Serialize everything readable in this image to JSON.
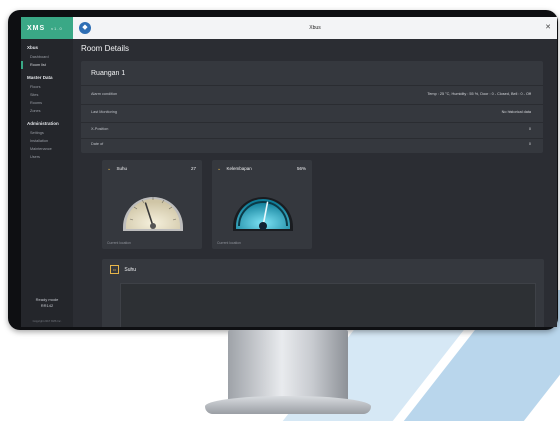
{
  "sidebar": {
    "logo": "XMS",
    "version": "v1.0",
    "sections": [
      {
        "title": "Xbus",
        "items": [
          "Dashboard",
          "Room list"
        ]
      },
      {
        "title": "Master Data",
        "items": [
          "Floors",
          "Sites",
          "Rooms",
          "Zones"
        ]
      },
      {
        "title": "Administration",
        "items": [
          "Settings",
          "Installation",
          "Maintenance",
          "Users"
        ]
      }
    ],
    "active_item": "Room list",
    "footer_line1": "Ready mode",
    "footer_line2": "RR142",
    "copyright": "Copyright 2017 XMS Inc."
  },
  "topbar": {
    "title": "Xbus",
    "close_glyph": "✕"
  },
  "page": {
    "title": "Room Details"
  },
  "room": {
    "name": "Ruangan 1",
    "rows": [
      {
        "key": "Alarm condition",
        "value": "Temp : 25 °C, Humidity : 55 %, Door : 0 - Closed, Bell : 0 - Off"
      },
      {
        "key": "Last Monitoring",
        "value": "No historical data"
      },
      {
        "key": "X-Position",
        "value": "0"
      },
      {
        "key": "Date of",
        "value": "0"
      }
    ]
  },
  "gauges": [
    {
      "title": "Suhu",
      "value": "27",
      "footer": "Current location",
      "fill": 0.4
    },
    {
      "title": "Kelembapan",
      "value": "56%",
      "footer": "Current location",
      "fill": 0.56
    }
  ],
  "chart_card": {
    "title": "Suhu",
    "ticks": [
      "",
      "",
      ""
    ]
  },
  "colors": {
    "accent": "#3aa886",
    "gauge_chevron": "#e6b54a",
    "app_icon": "#2f6fb5"
  }
}
